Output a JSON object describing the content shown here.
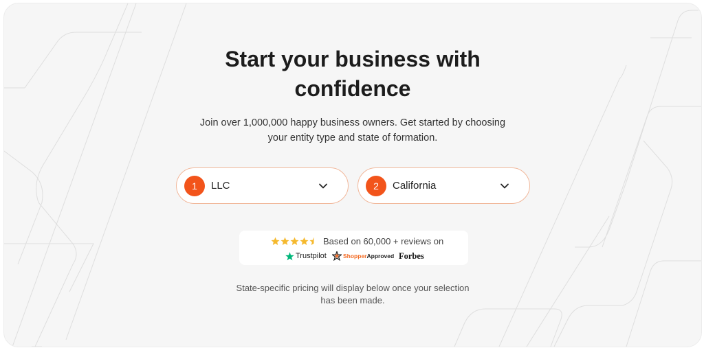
{
  "hero": {
    "title_line1": "Start your business with",
    "title_line2": "confidence",
    "subtitle_line1": "Join over 1,000,000 happy business owners. Get started by choosing",
    "subtitle_line2": "your entity type and state of formation."
  },
  "selectors": [
    {
      "step": "1",
      "value": "LLC",
      "icon": "chevron-down-icon"
    },
    {
      "step": "2",
      "value": "California",
      "icon": "chevron-down-icon"
    }
  ],
  "reviews": {
    "rating": 4.5,
    "rating_max": 5,
    "text": "Based on 60,000 + reviews on",
    "brands": [
      {
        "name": "Trustpilot",
        "icon": "trustpilot-star-icon"
      },
      {
        "name_part1": "Shopper",
        "name_part2": "Approved",
        "icon": "shopper-approved-star-icon"
      },
      {
        "name": "Forbes"
      }
    ]
  },
  "footnote": {
    "line1": "State-specific pricing will display below once your selection",
    "line2": "has been made."
  },
  "colors": {
    "accent": "#f2541b",
    "star": "#f5b92e",
    "trustpilot": "#00b67a",
    "background": "#f6f6f6"
  }
}
